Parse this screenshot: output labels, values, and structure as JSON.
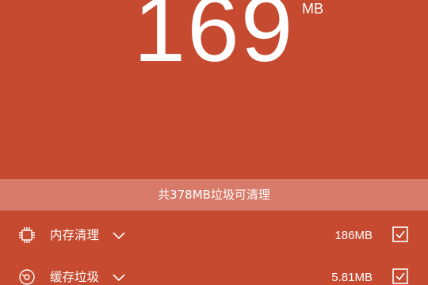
{
  "header": {
    "junk_size_value": "169",
    "junk_size_unit": "MB"
  },
  "summary": {
    "text": "共378MB垃圾可清理"
  },
  "items": [
    {
      "label": "内存清理",
      "size": "186MB",
      "icon": "chip-icon",
      "checked": true
    },
    {
      "label": "缓存垃圾",
      "size": "5.81MB",
      "icon": "cache-icon",
      "checked": true
    }
  ],
  "colors": {
    "background": "#c64a2f",
    "summary_bar": "#d77a69",
    "foreground": "#ffffff"
  }
}
